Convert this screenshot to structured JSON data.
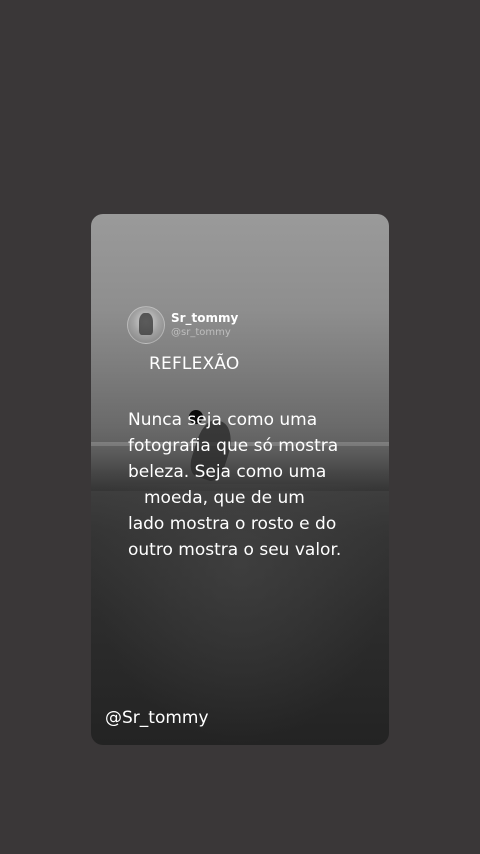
{
  "post": {
    "display_name": "Sr_tommy",
    "handle": "@sr_tommy",
    "heading": "REFLEXÃO",
    "quote_lines": [
      "Nunca seja como uma",
      "fotografia que só mostra",
      "beleza. Seja como uma",
      "moeda, que de um",
      "lado mostra o rosto e do",
      "outro mostra o seu valor."
    ],
    "watermark": "@Sr_tommy"
  },
  "colors": {
    "background": "#3a3738",
    "text": "#ffffff"
  },
  "icons": {
    "avatar": "profile-avatar"
  }
}
